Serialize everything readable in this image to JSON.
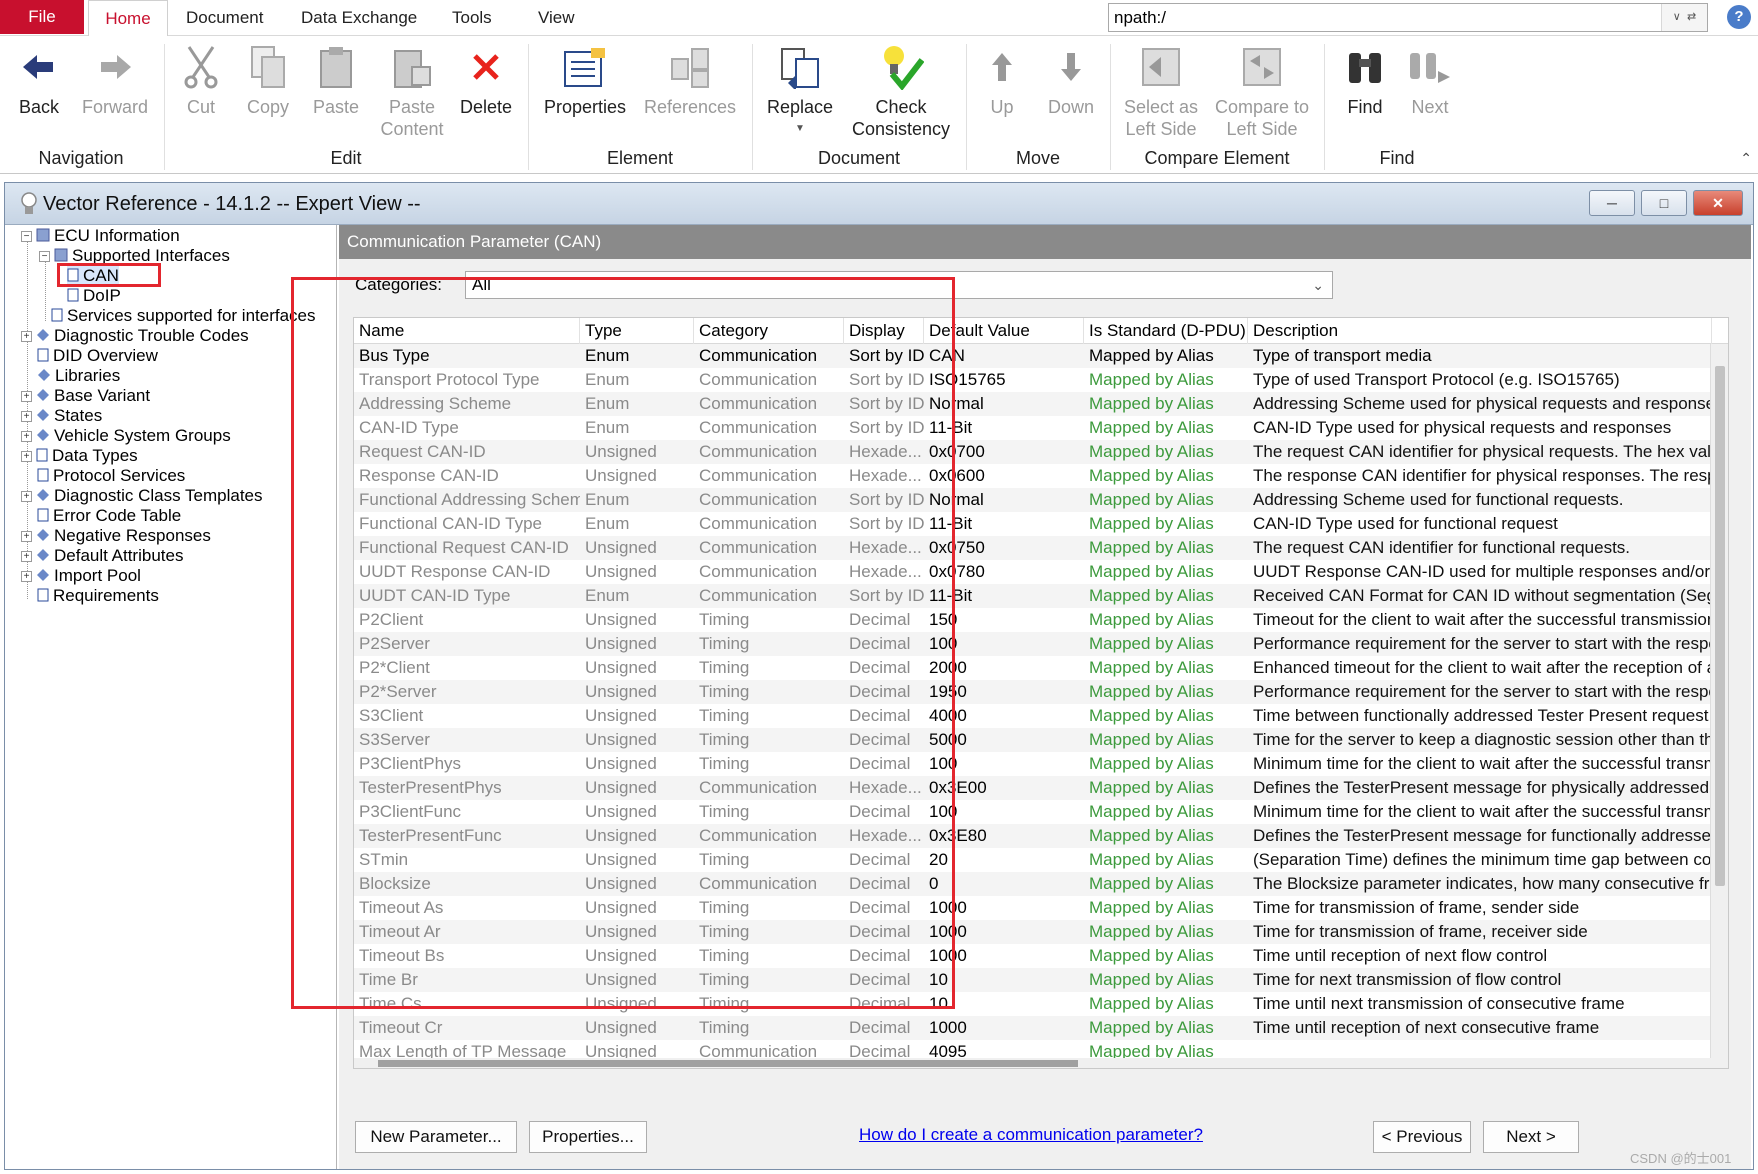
{
  "menu": {
    "file": "File",
    "tabs": [
      "Home",
      "Document",
      "Data Exchange",
      "Tools",
      "View"
    ]
  },
  "npath": {
    "value": "npath:/",
    "help": "?"
  },
  "ribbon": {
    "back": "Back",
    "forward": "Forward",
    "cut": "Cut",
    "copy": "Copy",
    "paste": "Paste",
    "paste_content_1": "Paste",
    "paste_content_2": "Content",
    "delete": "Delete",
    "properties": "Properties",
    "references": "References",
    "replace": "Replace",
    "check_1": "Check",
    "check_2": "Consistency",
    "up": "Up",
    "down": "Down",
    "select_left_1": "Select as",
    "select_left_2": "Left Side",
    "compare_left_1": "Compare to",
    "compare_left_2": "Left Side",
    "find": "Find",
    "next": "Next",
    "groups": {
      "navigation": "Navigation",
      "edit": "Edit",
      "element": "Element",
      "document": "Document",
      "move": "Move",
      "compare": "Compare Element",
      "find": "Find"
    }
  },
  "window": {
    "title": "Vector Reference - 14.1.2 -- Expert View --"
  },
  "tree": {
    "ecu": "ECU Information",
    "supported": "Supported Interfaces",
    "can": "CAN",
    "doip": "DoIP",
    "services_if": "Services supported for interfaces",
    "dtc": "Diagnostic Trouble Codes",
    "did": "DID Overview",
    "libraries": "Libraries",
    "base_variant": "Base Variant",
    "states": "States",
    "vsg": "Vehicle System Groups",
    "data_types": "Data Types",
    "protocol_services": "Protocol Services",
    "dct": "Diagnostic Class Templates",
    "error_code": "Error Code Table",
    "neg_resp": "Negative Responses",
    "default_attr": "Default Attributes",
    "import_pool": "Import Pool",
    "requirements": "Requirements"
  },
  "panel": {
    "header": "Communication Parameter (CAN)",
    "categories_label": "Categories:",
    "categories_value": "All"
  },
  "table": {
    "columns": [
      "Name",
      "Type",
      "Category",
      "Display",
      "Default Value",
      "Is Standard (D-PDU)",
      "Description"
    ],
    "rows": [
      [
        "Bus Type",
        "Enum",
        "Communication",
        "Sort by ID",
        "CAN",
        "Mapped by Alias",
        "Type of transport media"
      ],
      [
        "Transport Protocol Type",
        "Enum",
        "Communication",
        "Sort by ID",
        "ISO15765",
        "Mapped by Alias",
        "Type of used Transport Protocol (e.g. ISO15765)"
      ],
      [
        "Addressing Scheme",
        "Enum",
        "Communication",
        "Sort by ID",
        "Normal",
        "Mapped by Alias",
        "Addressing Scheme used for physical requests and responses"
      ],
      [
        "CAN-ID Type",
        "Enum",
        "Communication",
        "Sort by ID",
        "11-Bit",
        "Mapped by Alias",
        "CAN-ID Type used for physical requests and responses"
      ],
      [
        "Request CAN-ID",
        "Unsigned",
        "Communication",
        "Hexade...",
        "0x0700",
        "Mapped by Alias",
        "The request CAN identifier for physical requests. The hex value"
      ],
      [
        "Response CAN-ID",
        "Unsigned",
        "Communication",
        "Hexade...",
        "0x0600",
        "Mapped by Alias",
        "The response CAN identifier for physical responses. The respo"
      ],
      [
        "Functional Addressing Scheme",
        "Enum",
        "Communication",
        "Sort by ID",
        "Normal",
        "Mapped by Alias",
        "Addressing Scheme used for functional requests."
      ],
      [
        "Functional CAN-ID Type",
        "Enum",
        "Communication",
        "Sort by ID",
        "11-Bit",
        "Mapped by Alias",
        "CAN-ID Type used for functional request"
      ],
      [
        "Functional Request CAN-ID",
        "Unsigned",
        "Communication",
        "Hexade...",
        "0x0750",
        "Mapped by Alias",
        "The request CAN identifier for functional requests."
      ],
      [
        "UUDT Response CAN-ID",
        "Unsigned",
        "Communication",
        "Hexade...",
        "0x0780",
        "Mapped by Alias",
        "UUDT Response CAN-ID used for multiple responses and/or p"
      ],
      [
        "UUDT CAN-ID Type",
        "Enum",
        "Communication",
        "Sort by ID",
        "11-Bit",
        "Mapped by Alias",
        "Received CAN Format for CAN ID without segmentation (Segr"
      ],
      [
        "P2Client",
        "Unsigned",
        "Timing",
        "Decimal",
        "150",
        "Mapped by Alias",
        "Timeout for the client to wait after the successful transmission"
      ],
      [
        "P2Server",
        "Unsigned",
        "Timing",
        "Decimal",
        "100",
        "Mapped by Alias",
        "Performance requirement for the server to start with the respor"
      ],
      [
        "P2*Client",
        "Unsigned",
        "Timing",
        "Decimal",
        "2000",
        "Mapped by Alias",
        "Enhanced timeout for the client to wait after the reception of a"
      ],
      [
        "P2*Server",
        "Unsigned",
        "Timing",
        "Decimal",
        "1950",
        "Mapped by Alias",
        "Performance requirement for the server to start with the respor"
      ],
      [
        "S3Client",
        "Unsigned",
        "Timing",
        "Decimal",
        "4000",
        "Mapped by Alias",
        "Time between functionally addressed Tester Present request n"
      ],
      [
        "S3Server",
        "Unsigned",
        "Timing",
        "Decimal",
        "5000",
        "Mapped by Alias",
        "Time for the server to keep a diagnostic session other than the"
      ],
      [
        "P3ClientPhys",
        "Unsigned",
        "Timing",
        "Decimal",
        "100",
        "Mapped by Alias",
        "Minimum time for the client to wait after the successful transmi"
      ],
      [
        "TesterPresentPhys",
        "Unsigned",
        "Communication",
        "Hexade...",
        "0x3E00",
        "Mapped by Alias",
        "Defines the TesterPresent message for physically addressed r"
      ],
      [
        "P3ClientFunc",
        "Unsigned",
        "Timing",
        "Decimal",
        "100",
        "Mapped by Alias",
        "Minimum time for the client to wait after the successful transmi"
      ],
      [
        "TesterPresentFunc",
        "Unsigned",
        "Communication",
        "Hexade...",
        "0x3E80",
        "Mapped by Alias",
        "Defines the TesterPresent message for functionally addressec"
      ],
      [
        "STmin",
        "Unsigned",
        "Timing",
        "Decimal",
        "20",
        "Mapped by Alias",
        "(Separation Time) defines the minimum time gap between con"
      ],
      [
        "Blocksize",
        "Unsigned",
        "Communication",
        "Decimal",
        "0",
        "Mapped by Alias",
        "The Blocksize parameter indicates, how many consecutive frar"
      ],
      [
        "Timeout As",
        "Unsigned",
        "Timing",
        "Decimal",
        "1000",
        "Mapped by Alias",
        "Time for transmission of frame, sender side"
      ],
      [
        "Timeout Ar",
        "Unsigned",
        "Timing",
        "Decimal",
        "1000",
        "Mapped by Alias",
        "Time for transmission of frame, receiver side"
      ],
      [
        "Timeout Bs",
        "Unsigned",
        "Timing",
        "Decimal",
        "1000",
        "Mapped by Alias",
        "Time until reception of next flow control"
      ],
      [
        "Time Br",
        "Unsigned",
        "Timing",
        "Decimal",
        "10",
        "Mapped by Alias",
        "Time for next transmission of flow control"
      ],
      [
        "Time Cs",
        "Unsigned",
        "Timing",
        "Decimal",
        "10",
        "Mapped by Alias",
        "Time until next transmission of consecutive frame"
      ],
      [
        "Timeout Cr",
        "Unsigned",
        "Timing",
        "Decimal",
        "1000",
        "Mapped by Alias",
        "Time until reception of next consecutive frame"
      ],
      [
        "Max Length of TP Message",
        "Unsigned",
        "Communication",
        "Decimal",
        "4095",
        "Mapped by Alias",
        ""
      ]
    ]
  },
  "buttons": {
    "new_param": "New Parameter...",
    "properties": "Properties...",
    "help_link": "How do I create a communication parameter?",
    "previous": "< Previous",
    "next": "Next >"
  },
  "watermark": "CSDN @的士001",
  "colors": {
    "file_tab": "#c8102e",
    "mapped": "#3c9a3c",
    "highlight": "#e3262e",
    "panel_header": "#8a8a8a"
  }
}
